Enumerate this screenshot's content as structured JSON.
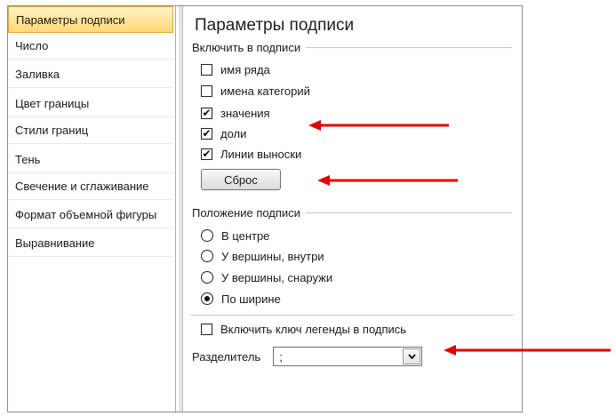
{
  "nav": {
    "items": [
      {
        "label": "Параметры подписи"
      },
      {
        "label": "Число"
      },
      {
        "label": "Заливка"
      },
      {
        "label": "Цвет границы"
      },
      {
        "label": "Стили границ"
      },
      {
        "label": "Тень"
      },
      {
        "label": "Свечение и сглаживание"
      },
      {
        "label": "Формат объемной фигуры"
      },
      {
        "label": "Выравнивание"
      }
    ],
    "selected_index": 0
  },
  "panel": {
    "title": "Параметры подписи",
    "include": {
      "label": "Включить в подписи",
      "options": [
        {
          "label": "имя ряда",
          "checked": false
        },
        {
          "label": "имена категорий",
          "checked": false
        },
        {
          "label": "значения",
          "checked": true
        },
        {
          "label": "доли",
          "checked": true
        },
        {
          "label": "Линии выноски",
          "checked": true
        }
      ],
      "reset_label": "Сброс"
    },
    "position": {
      "label": "Положение подписи",
      "options": [
        {
          "label": "В центре",
          "selected": false
        },
        {
          "label": "У вершины, внутри",
          "selected": false
        },
        {
          "label": "У вершины, снаружи",
          "selected": false
        },
        {
          "label": "По ширине",
          "selected": true
        }
      ]
    },
    "legend_key": {
      "label": "Включить ключ легенды в подпись",
      "checked": false
    },
    "separator": {
      "label": "Разделитель",
      "value": ";"
    }
  },
  "colors": {
    "annotation_arrow": "#e00000",
    "nav_selected": "#ffd877"
  }
}
